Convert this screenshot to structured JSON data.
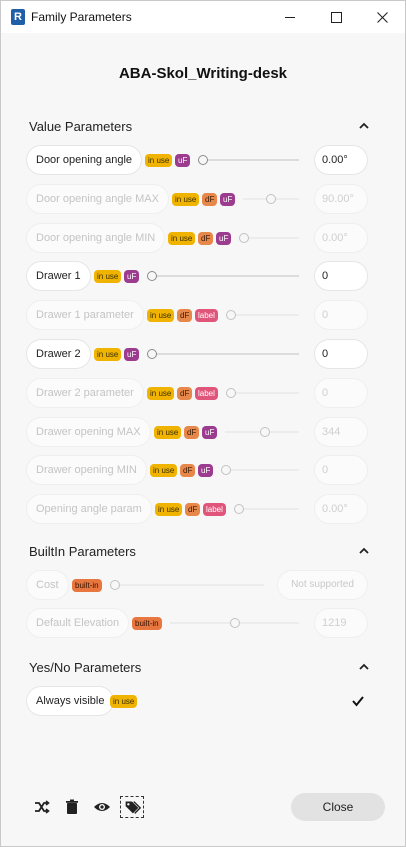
{
  "window": {
    "title": "Family Parameters",
    "app_icon_letter": "R",
    "minimize_glyph": "—",
    "maximize_glyph": "☐",
    "close_glyph": "✕"
  },
  "family_name": "ABA-Skol_Writing-desk",
  "sections": {
    "value": {
      "title": "Value Parameters",
      "rows": [
        {
          "label": "Door opening angle",
          "badges": [
            "in use",
            "uF"
          ],
          "value": "0.00°",
          "enabled": true,
          "slider_fraction": 0.0
        },
        {
          "label": "Door opening angle MAX",
          "badges": [
            "in use",
            "dF",
            "uF"
          ],
          "value": "90.00°",
          "enabled": false,
          "slider_fraction": 0.5
        },
        {
          "label": "Door opening angle MIN",
          "badges": [
            "in use",
            "dF",
            "uF"
          ],
          "value": "0.00°",
          "enabled": false,
          "slider_fraction": 0.0
        },
        {
          "label": "Drawer 1",
          "badges": [
            "in use",
            "uF"
          ],
          "value": "0",
          "enabled": true,
          "slider_fraction": 0.0
        },
        {
          "label": "Drawer 1 parameter",
          "badges": [
            "in use",
            "dF",
            "label"
          ],
          "value": "0",
          "enabled": false,
          "slider_fraction": 0.0
        },
        {
          "label": "Drawer 2",
          "badges": [
            "in use",
            "uF"
          ],
          "value": "0",
          "enabled": true,
          "slider_fraction": 0.0
        },
        {
          "label": "Drawer 2 parameter",
          "badges": [
            "in use",
            "dF",
            "label"
          ],
          "value": "0",
          "enabled": false,
          "slider_fraction": 0.0
        },
        {
          "label": "Drawer opening MAX",
          "badges": [
            "in use",
            "dF",
            "uF"
          ],
          "value": "344",
          "enabled": false,
          "slider_fraction": 0.55
        },
        {
          "label": "Drawer opening MIN",
          "badges": [
            "in use",
            "dF",
            "uF"
          ],
          "value": "0",
          "enabled": false,
          "slider_fraction": 0.0
        },
        {
          "label": "Opening angle param",
          "badges": [
            "in use",
            "dF",
            "label"
          ],
          "value": "0.00°",
          "enabled": false,
          "slider_fraction": 0.0
        }
      ]
    },
    "builtin": {
      "title": "BuiltIn Parameters",
      "rows": [
        {
          "label": "Cost",
          "badges": [
            "built-in"
          ],
          "value": "Not supported",
          "enabled": false,
          "slider_fraction": 0.0
        },
        {
          "label": "Default Elevation",
          "badges": [
            "built-in"
          ],
          "value": "1219",
          "enabled": false,
          "slider_fraction": 0.5
        }
      ]
    },
    "yesno": {
      "title": "Yes/No Parameters",
      "rows": [
        {
          "label": "Always visible",
          "badges": [
            "in use"
          ],
          "checked": true
        }
      ]
    }
  },
  "footer": {
    "icons": [
      "shuffle-icon",
      "trash-icon",
      "eye-icon",
      "tags-icon"
    ],
    "close_label": "Close"
  },
  "colors": {
    "in_use": "#f0b400",
    "uF": "#9c3c8f",
    "dF": "#e8874a",
    "label": "#e0567a",
    "built_in": "#e8763f"
  }
}
